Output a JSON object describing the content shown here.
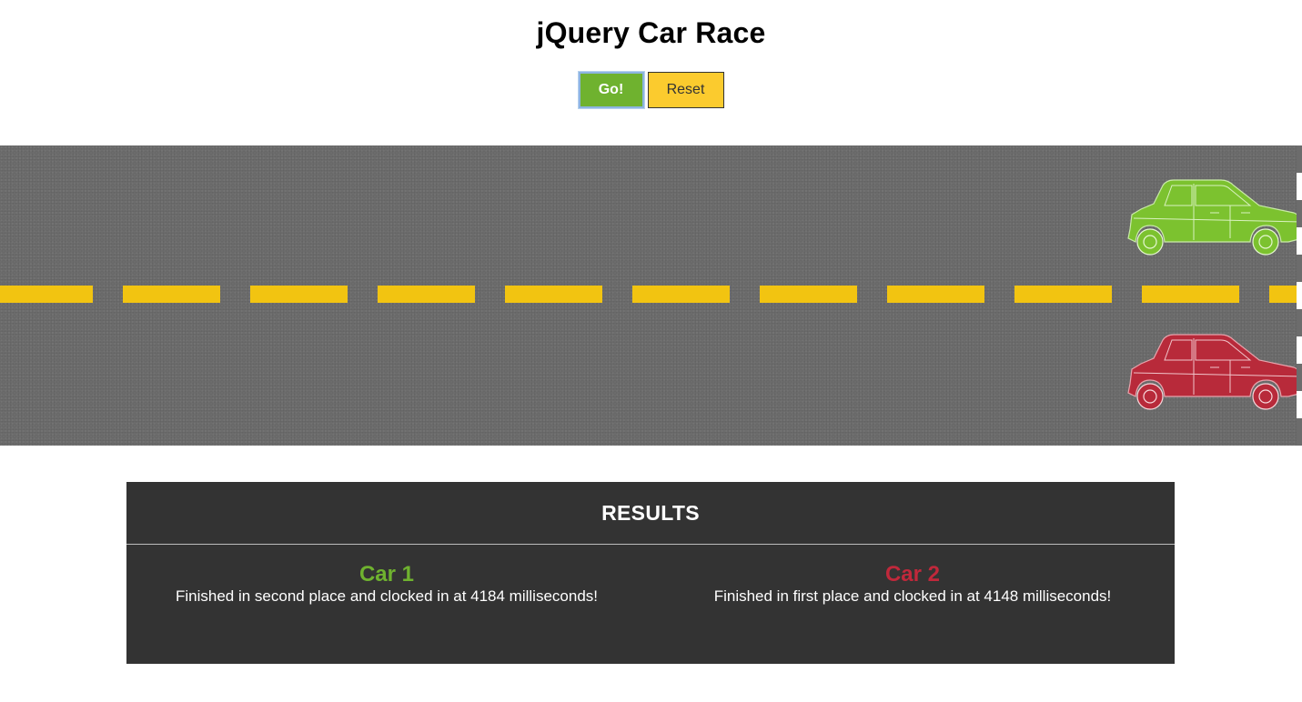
{
  "page": {
    "title": "jQuery Car Race"
  },
  "controls": {
    "go_label": "Go!",
    "reset_label": "Reset"
  },
  "colors": {
    "go_button": "#6fb22f",
    "reset_button": "#fbcb2e",
    "track": "#6c6c6c",
    "lane_line": "#f2c411",
    "car_1": "#7cc22f",
    "car_2": "#b82a3a",
    "results_bg": "#333333"
  },
  "track": {
    "cars": [
      {
        "name": "Car 1",
        "color": "green",
        "icon": "car-icon"
      },
      {
        "name": "Car 2",
        "color": "red",
        "icon": "car-icon"
      }
    ]
  },
  "results": {
    "heading": "RESULTS",
    "entries": [
      {
        "car": "Car 1",
        "text": "Finished in second place and clocked in at 4184 milliseconds!"
      },
      {
        "car": "Car 2",
        "text": "Finished in first place and clocked in at 4148 milliseconds!"
      }
    ]
  }
}
